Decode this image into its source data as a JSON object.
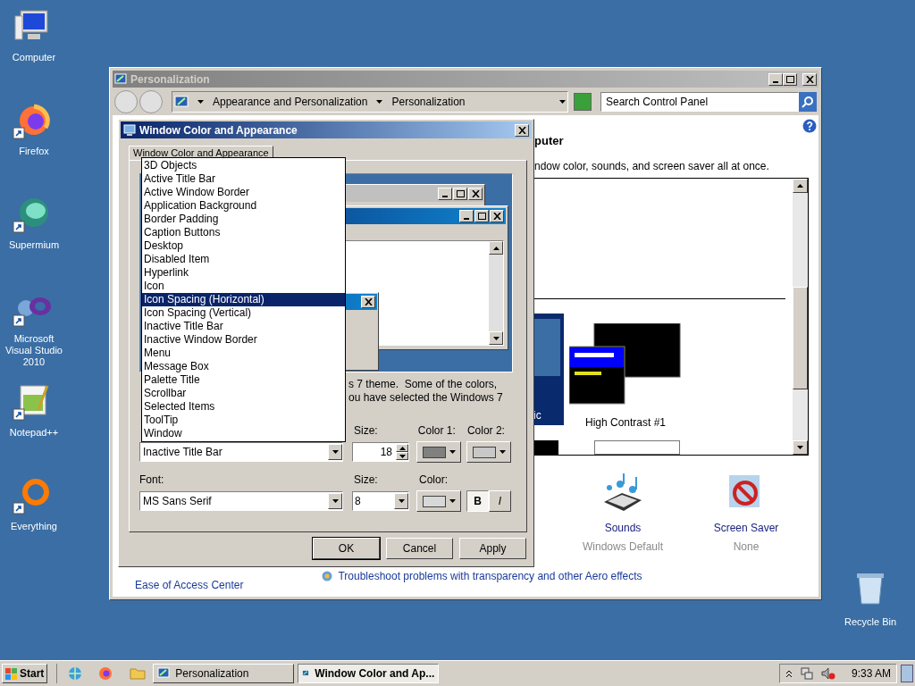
{
  "desktop_icons": [
    {
      "label": "Computer",
      "kind": "computer",
      "shortcut": false
    },
    {
      "label": "Firefox",
      "kind": "firefox",
      "shortcut": true
    },
    {
      "label": "Supermium",
      "kind": "supermium",
      "shortcut": true
    },
    {
      "label": "Microsoft Visual Studio 2010",
      "kind": "visualstudio",
      "shortcut": true
    },
    {
      "label": "Notepad++",
      "kind": "notepad",
      "shortcut": true
    },
    {
      "label": "Everything",
      "kind": "everything",
      "shortcut": true
    }
  ],
  "recycle_bin": {
    "label": "Recycle Bin"
  },
  "personalization_window": {
    "title": "Personalization",
    "breadcrumb": [
      "Appearance and Personalization",
      "Personalization"
    ],
    "search": {
      "placeholder": "Search Control Panel"
    },
    "heading": "puter",
    "description": "ndow color, sounds, and screen saver all at once.",
    "themes": [
      {
        "label": "ic",
        "kind": "classic"
      },
      {
        "label": "High Contrast #1",
        "kind": "contrast"
      }
    ],
    "settings": [
      {
        "label": "Sounds",
        "value": "Windows Default",
        "kind": "sounds"
      },
      {
        "label": "Screen Saver",
        "value": "None",
        "kind": "screensaver"
      }
    ],
    "see_also_link": "Ease of Access Center",
    "troubleshoot_link": "Troubleshoot problems with transparency and other Aero effects"
  },
  "dialog": {
    "title": "Window Color and Appearance",
    "tabs": [
      {
        "label": "Window Color and Appearance",
        "selected": true
      }
    ],
    "note_lines": [
      "s 7 theme.  Some of the colors,",
      "ou have selected the Windows 7"
    ],
    "item_list": [
      {
        "label": "3D Objects",
        "selected": false
      },
      {
        "label": "Active Title Bar",
        "selected": false
      },
      {
        "label": "Active Window Border",
        "selected": false
      },
      {
        "label": "Application Background",
        "selected": false
      },
      {
        "label": "Border Padding",
        "selected": false
      },
      {
        "label": "Caption Buttons",
        "selected": false
      },
      {
        "label": "Desktop",
        "selected": false
      },
      {
        "label": "Disabled Item",
        "selected": false
      },
      {
        "label": "Hyperlink",
        "selected": false
      },
      {
        "label": "Icon",
        "selected": false
      },
      {
        "label": "Icon Spacing (Horizontal)",
        "selected": true
      },
      {
        "label": "Icon Spacing (Vertical)",
        "selected": false
      },
      {
        "label": "Inactive Title Bar",
        "selected": false
      },
      {
        "label": "Inactive Window Border",
        "selected": false
      },
      {
        "label": "Menu",
        "selected": false
      },
      {
        "label": "Message Box",
        "selected": false
      },
      {
        "label": "Palette Title",
        "selected": false
      },
      {
        "label": "Scrollbar",
        "selected": false
      },
      {
        "label": "Selected Items",
        "selected": false
      },
      {
        "label": "ToolTip",
        "selected": false
      },
      {
        "label": "Window",
        "selected": false
      }
    ],
    "item": {
      "value": "Inactive Title Bar",
      "size_label": "Size:",
      "size": "18",
      "color_buttons": [
        {
          "label": "Color 1:",
          "color": "#808080"
        },
        {
          "label": "Color 2:",
          "color": "#c8c8c8"
        }
      ]
    },
    "font": {
      "label": "Font:",
      "value": "MS Sans Serif",
      "size_label": "Size:",
      "size": "8",
      "color_buttons": [
        {
          "label": "Color:",
          "color": "#d8d8d8"
        }
      ],
      "styles": [
        {
          "label": "B",
          "pressed": true,
          "kind": "bold"
        },
        {
          "label": "I",
          "pressed": false,
          "kind": "italic"
        }
      ]
    },
    "buttons": [
      {
        "label": "OK",
        "default": true
      },
      {
        "label": "Cancel",
        "default": false
      },
      {
        "label": "Apply",
        "default": false
      }
    ]
  },
  "taskbar": {
    "start": "Start",
    "tasks": [
      {
        "label": "Personalization",
        "selected": false
      },
      {
        "label": "Window Color and Ap...",
        "selected": true
      }
    ],
    "clock": "9:33 AM"
  }
}
